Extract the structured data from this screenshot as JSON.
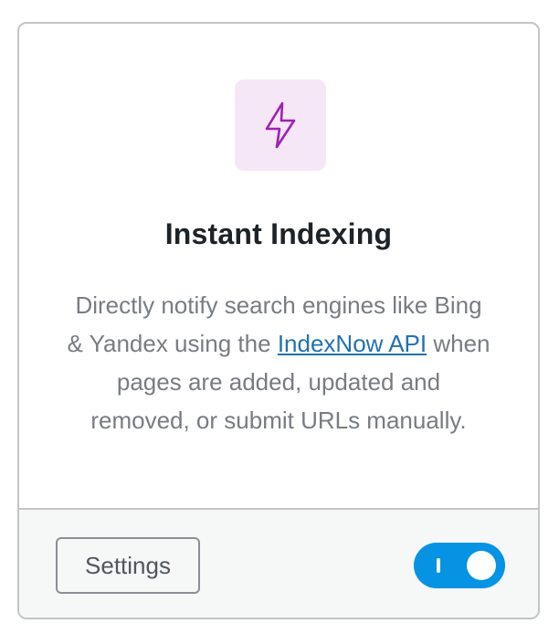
{
  "module": {
    "icon": "lightning-bolt-icon",
    "icon_color": "#a020b4",
    "icon_bg_color": "#f5e7f6",
    "title": "Instant Indexing",
    "description_before": "Directly notify search engines like Bing & Yandex using the ",
    "description_link": "IndexNow API",
    "description_after": " when pages are added, updated and removed, or submit URLs manually.",
    "link_color": "#2271b1"
  },
  "footer": {
    "settings_label": "Settings",
    "toggle_state": "on",
    "toggle_color": "#0693e3"
  }
}
